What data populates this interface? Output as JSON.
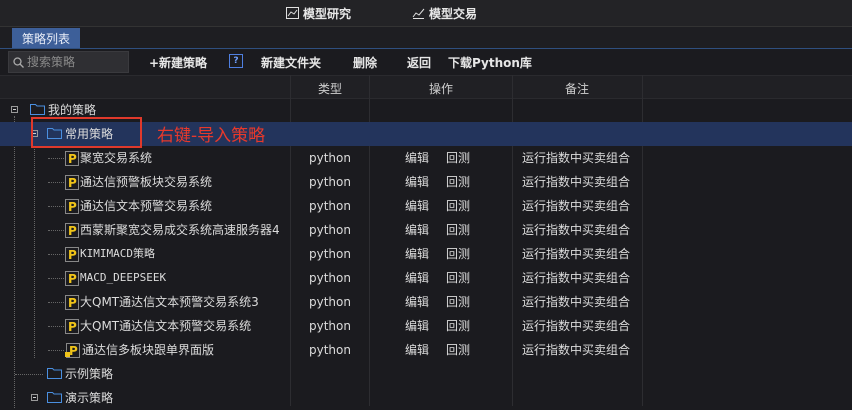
{
  "topbar": {
    "tabs": [
      {
        "label": "模型研究",
        "icon": "chart-icon"
      },
      {
        "label": "模型交易",
        "icon": "trade-chart-icon"
      }
    ]
  },
  "tabstrip": {
    "active_label": "策略列表"
  },
  "toolbar": {
    "search_placeholder": "搜索策略",
    "new_strategy": "+新建策略",
    "help": "?",
    "new_folder": "新建文件夹",
    "delete": "删除",
    "back": "返回",
    "download": "下载Python库"
  },
  "columns": {
    "type": "类型",
    "action": "操作",
    "note": "备注"
  },
  "tree": {
    "root": "我的策略",
    "group": "常用策略",
    "items": [
      {
        "name": "聚宽交易系统",
        "type": "python",
        "edit": "编辑",
        "backtest": "回测",
        "note": "运行指数中买卖组合",
        "locked": false
      },
      {
        "name": "通达信预警板块交易系统",
        "type": "python",
        "edit": "编辑",
        "backtest": "回测",
        "note": "运行指数中买卖组合",
        "locked": false
      },
      {
        "name": "通达信文本预警交易系统",
        "type": "python",
        "edit": "编辑",
        "backtest": "回测",
        "note": "运行指数中买卖组合",
        "locked": false
      },
      {
        "name": "西蒙斯聚宽交易成交系统高速服务器4",
        "type": "python",
        "edit": "编辑",
        "backtest": "回测",
        "note": "运行指数中买卖组合",
        "locked": false
      },
      {
        "name": "KIMIMACD策略",
        "type": "python",
        "edit": "编辑",
        "backtest": "回测",
        "note": "运行指数中买卖组合",
        "locked": false
      },
      {
        "name": "MACD_DEEPSEEK",
        "type": "python",
        "edit": "编辑",
        "backtest": "回测",
        "note": "运行指数中买卖组合",
        "locked": false
      },
      {
        "name": "大QMT通达信文本预警交易系统3",
        "type": "python",
        "edit": "编辑",
        "backtest": "回测",
        "note": "运行指数中买卖组合",
        "locked": false
      },
      {
        "name": "大QMT通达信文本预警交易系统",
        "type": "python",
        "edit": "编辑",
        "backtest": "回测",
        "note": "运行指数中买卖组合",
        "locked": false
      },
      {
        "name": "通达信多板块跟单界面版",
        "type": "python",
        "edit": "编辑",
        "backtest": "回测",
        "note": "运行指数中买卖组合",
        "locked": true
      }
    ],
    "folder_examples": "示例策略",
    "folder_demo": "演示策略"
  },
  "annotation": {
    "text": "右键-导入策略",
    "color": "#e8392b"
  }
}
